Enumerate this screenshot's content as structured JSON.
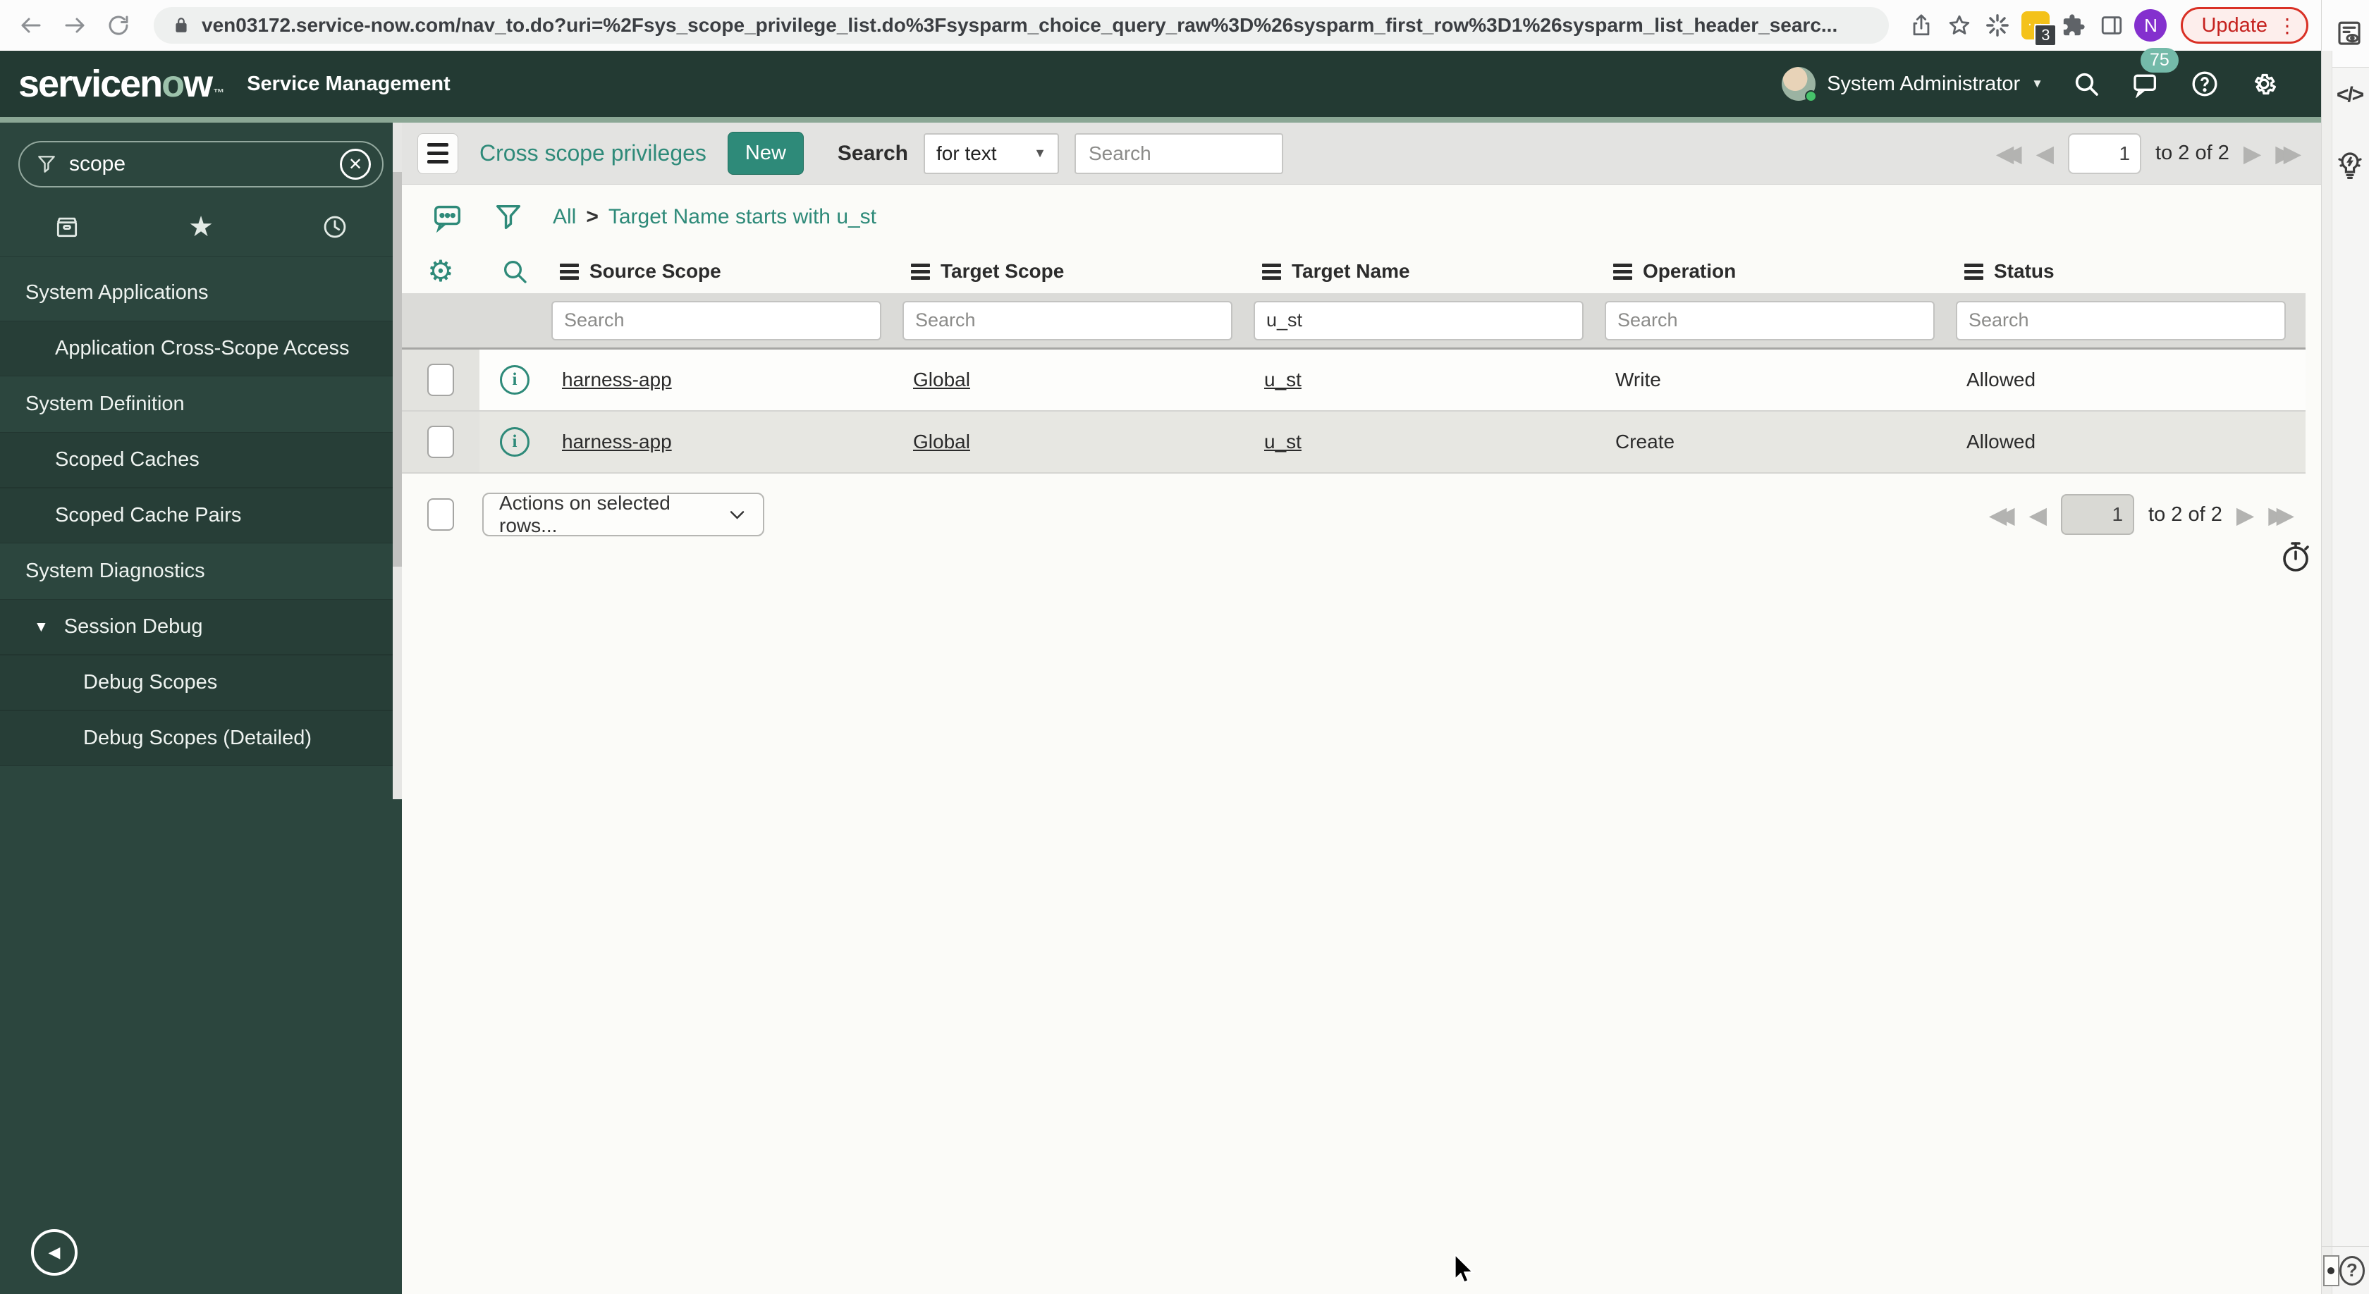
{
  "chrome": {
    "url": "ven03172.service-now.com/nav_to.do?uri=%2Fsys_scope_privilege_list.do%3Fsysparm_choice_query_raw%3D%26sysparm_first_row%3D1%26sysparm_list_header_searc...",
    "update_label": "Update",
    "extension_badge": "3",
    "extension_dots": "...",
    "avatar_letter": "N"
  },
  "header": {
    "logo_part1": "servicen",
    "logo_o": "o",
    "logo_part2": "w",
    "logo_tm": "™",
    "product": "Service Management",
    "user_name": "System Administrator",
    "notification_count": "75"
  },
  "sidebar": {
    "search_value": "scope",
    "items": [
      {
        "label": "System Applications",
        "type": "section"
      },
      {
        "label": "Application Cross-Scope Access",
        "type": "item"
      },
      {
        "label": "System Definition",
        "type": "section"
      },
      {
        "label": "Scoped Caches",
        "type": "item"
      },
      {
        "label": "Scoped Cache Pairs",
        "type": "item"
      },
      {
        "label": "System Diagnostics",
        "type": "section"
      },
      {
        "label": "Session Debug",
        "type": "item-expanded"
      },
      {
        "label": "Debug Scopes",
        "type": "subitem"
      },
      {
        "label": "Debug Scopes (Detailed)",
        "type": "subitem"
      }
    ]
  },
  "toolbar": {
    "title": "Cross scope privileges",
    "new_label": "New",
    "search_label": "Search",
    "search_type_value": "for text",
    "search_placeholder": "Search"
  },
  "breadcrumb": {
    "root": "All",
    "separator": ">",
    "current": "Target Name starts with u_st"
  },
  "pagination": {
    "page_value": "1",
    "range_text": "to 2 of 2"
  },
  "table": {
    "columns": [
      "Source Scope",
      "Target Scope",
      "Target Name",
      "Operation",
      "Status"
    ],
    "filter_placeholder": "Search",
    "filters": {
      "target_name_value": "u_st"
    },
    "rows": [
      {
        "source_scope": "harness-app",
        "target_scope": "Global",
        "target_name": "u_st",
        "operation": "Write",
        "status": "Allowed"
      },
      {
        "source_scope": "harness-app",
        "target_scope": "Global",
        "target_name": "u_st",
        "operation": "Create",
        "status": "Allowed"
      }
    ]
  },
  "actions": {
    "dropdown_label": "Actions on selected rows..."
  },
  "icons": {
    "gear": "⚙",
    "star_filled": "★",
    "caret_down": "▼",
    "collapse_left": "◀",
    "prev_first": "◀◀",
    "prev": "◀",
    "next": "▶",
    "next_last": "▶▶",
    "code": "</>",
    "help": "?",
    "info": "i",
    "clear": "✕",
    "menu_dots": "⋮"
  },
  "colors": {
    "accent_teal": "#2e8a79",
    "header_green": "#233a33",
    "sage_strip": "#8ba795"
  }
}
